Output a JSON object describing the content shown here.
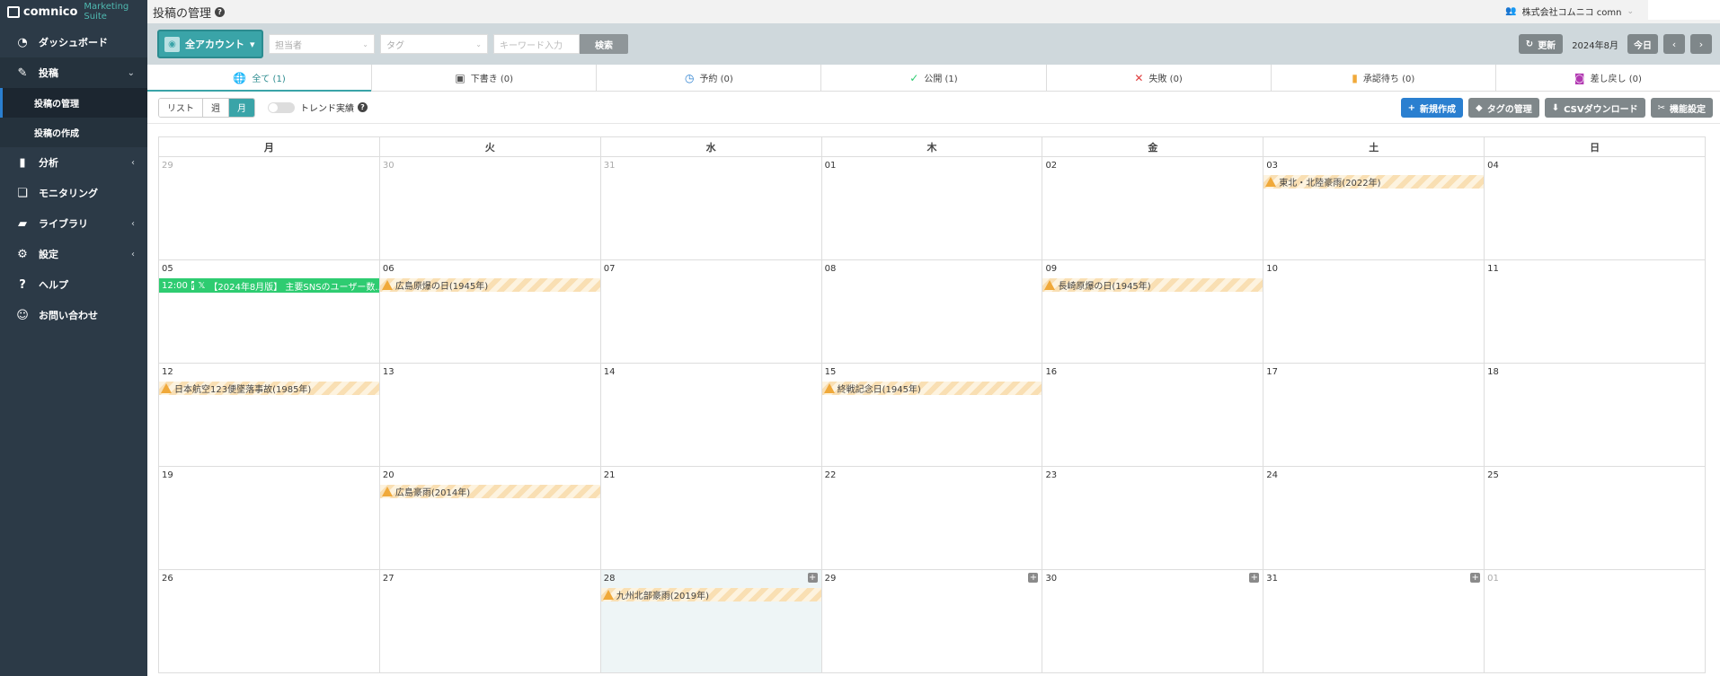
{
  "app": {
    "brand": "comnico",
    "suite": "Marketing Suite"
  },
  "sidebar": {
    "items": [
      {
        "label": "ダッシュボード"
      },
      {
        "label": "投稿"
      },
      {
        "label": "投稿の管理"
      },
      {
        "label": "投稿の作成"
      },
      {
        "label": "分析"
      },
      {
        "label": "モニタリング"
      },
      {
        "label": "ライブラリ"
      },
      {
        "label": "設定"
      },
      {
        "label": "ヘルプ"
      },
      {
        "label": "お問い合わせ"
      }
    ]
  },
  "header": {
    "title": "投稿の管理",
    "company": "株式会社コムニコ comn"
  },
  "filters": {
    "account_label": "全アカウント",
    "assignee_placeholder": "担当者",
    "tag_placeholder": "タグ",
    "keyword_placeholder": "キーワード入力",
    "search_label": "検索",
    "refresh_label": "更新",
    "month_label": "2024年8月",
    "today_label": "今日",
    "prev_label": "‹",
    "next_label": "›"
  },
  "status_tabs": [
    {
      "label": "全て (1)"
    },
    {
      "label": "下書き (0)"
    },
    {
      "label": "予約 (0)"
    },
    {
      "label": "公開 (1)"
    },
    {
      "label": "失敗 (0)"
    },
    {
      "label": "承認待ち (0)"
    },
    {
      "label": "差し戻し (0)"
    }
  ],
  "views": {
    "list": "リスト",
    "week": "週",
    "month": "月",
    "trend_label": "トレンド実績"
  },
  "actions": {
    "new_label": "新規作成",
    "tags_label": "タグの管理",
    "csv_label": "CSVダウンロード",
    "settings_label": "機能設定"
  },
  "calendar": {
    "weekdays": [
      "月",
      "火",
      "水",
      "木",
      "金",
      "土",
      "日"
    ],
    "weeks": [
      [
        "29",
        "30",
        "31",
        "01",
        "02",
        "03",
        "04"
      ],
      [
        "05",
        "06",
        "07",
        "08",
        "09",
        "10",
        "11"
      ],
      [
        "12",
        "13",
        "14",
        "15",
        "16",
        "17",
        "18"
      ],
      [
        "19",
        "20",
        "21",
        "22",
        "23",
        "24",
        "25"
      ],
      [
        "26",
        "27",
        "28",
        "29",
        "30",
        "31",
        "01"
      ]
    ],
    "events": {
      "w0d5": "東北・北陸豪雨(2022年)",
      "w1d1": "広島原爆の日(1945年)",
      "w1d4": "長崎原爆の日(1945年)",
      "w2d0": "日本航空123便墜落事故(1985年)",
      "w2d3": "終戦記念日(1945年)",
      "w3d1": "広島豪雨(2014年)",
      "w4d2": "九州北部豪雨(2019年)"
    },
    "post": {
      "time": "12:00",
      "fb": "f",
      "x": "𝕏",
      "title": "【2024年8月版】 主要SNSのユーザー数..."
    },
    "plus_label": "+"
  }
}
